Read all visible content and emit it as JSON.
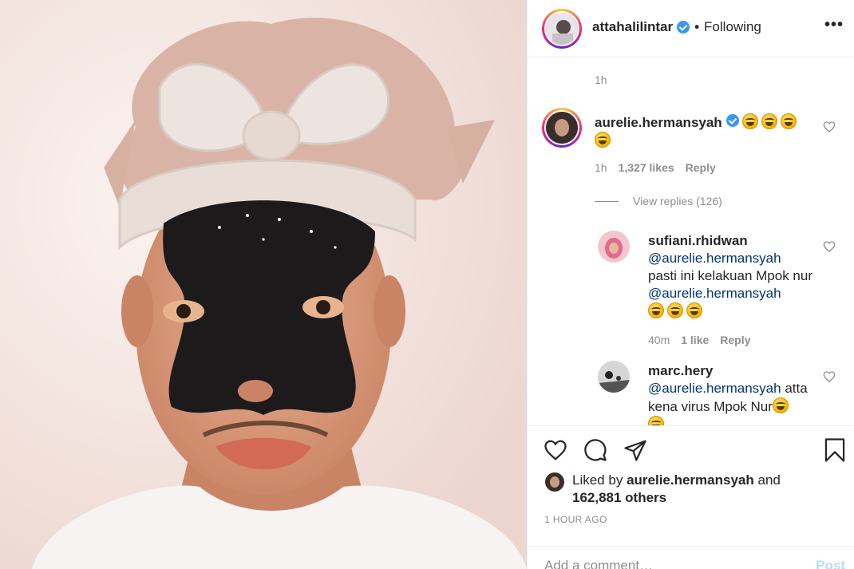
{
  "photo": {
    "subject": ""
  },
  "header": {
    "username": "attahalilintar",
    "separator": "•",
    "following": "Following",
    "more": "•••"
  },
  "comments": {
    "top_time": "1h",
    "main": {
      "username": "aurelie.hermansyah",
      "time": "1h",
      "likes": "1,327 likes",
      "reply": "Reply",
      "view_replies": "View replies (126)"
    },
    "replies": [
      {
        "username": "sufiani.rhidwan",
        "mention1": "@aurelie.hermansyah",
        "text": "pasti ini kelakuan Mpok nur",
        "mention2": "@aurelie.hermansyah",
        "time": "40m",
        "likes": "1 like",
        "reply": "Reply"
      },
      {
        "username": "marc.hery",
        "mention": "@aurelie.hermansyah",
        "text1": "atta",
        "text2": "kena virus Mpok Nur"
      }
    ]
  },
  "actions": {
    "liked_prefix": "Liked by",
    "liked_user": "aurelie.hermansyah",
    "liked_and": "and",
    "liked_others": "162,881 others",
    "time_ago": "1 HOUR AGO",
    "add_comment_placeholder": "Add a comment…",
    "post_label": "Post"
  },
  "colors": {
    "verified": "#3897f0",
    "mention": "#00376b",
    "post_disabled": "#b2dffc",
    "muted": "#8e8e8e"
  }
}
